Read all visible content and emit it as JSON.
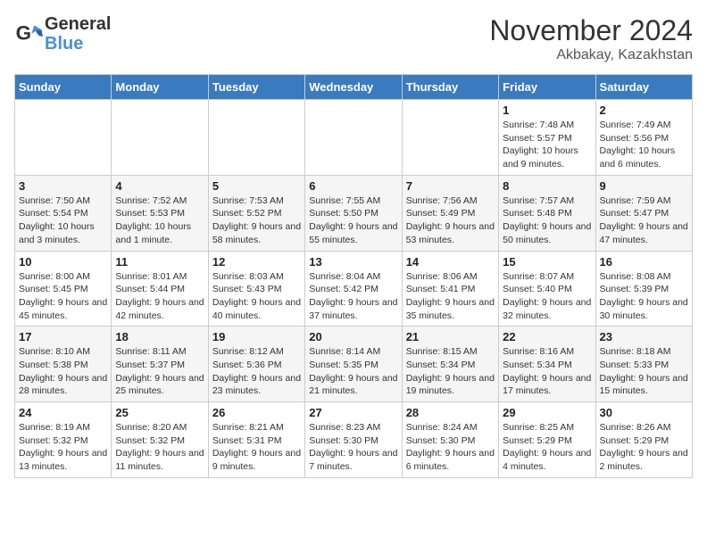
{
  "header": {
    "logo_line1": "General",
    "logo_line2": "Blue",
    "month_title": "November 2024",
    "location": "Akbakay, Kazakhstan"
  },
  "weekdays": [
    "Sunday",
    "Monday",
    "Tuesday",
    "Wednesday",
    "Thursday",
    "Friday",
    "Saturday"
  ],
  "weeks": [
    [
      {
        "day": "",
        "info": ""
      },
      {
        "day": "",
        "info": ""
      },
      {
        "day": "",
        "info": ""
      },
      {
        "day": "",
        "info": ""
      },
      {
        "day": "",
        "info": ""
      },
      {
        "day": "1",
        "info": "Sunrise: 7:48 AM\nSunset: 5:57 PM\nDaylight: 10 hours and 9 minutes."
      },
      {
        "day": "2",
        "info": "Sunrise: 7:49 AM\nSunset: 5:56 PM\nDaylight: 10 hours and 6 minutes."
      }
    ],
    [
      {
        "day": "3",
        "info": "Sunrise: 7:50 AM\nSunset: 5:54 PM\nDaylight: 10 hours and 3 minutes."
      },
      {
        "day": "4",
        "info": "Sunrise: 7:52 AM\nSunset: 5:53 PM\nDaylight: 10 hours and 1 minute."
      },
      {
        "day": "5",
        "info": "Sunrise: 7:53 AM\nSunset: 5:52 PM\nDaylight: 9 hours and 58 minutes."
      },
      {
        "day": "6",
        "info": "Sunrise: 7:55 AM\nSunset: 5:50 PM\nDaylight: 9 hours and 55 minutes."
      },
      {
        "day": "7",
        "info": "Sunrise: 7:56 AM\nSunset: 5:49 PM\nDaylight: 9 hours and 53 minutes."
      },
      {
        "day": "8",
        "info": "Sunrise: 7:57 AM\nSunset: 5:48 PM\nDaylight: 9 hours and 50 minutes."
      },
      {
        "day": "9",
        "info": "Sunrise: 7:59 AM\nSunset: 5:47 PM\nDaylight: 9 hours and 47 minutes."
      }
    ],
    [
      {
        "day": "10",
        "info": "Sunrise: 8:00 AM\nSunset: 5:45 PM\nDaylight: 9 hours and 45 minutes."
      },
      {
        "day": "11",
        "info": "Sunrise: 8:01 AM\nSunset: 5:44 PM\nDaylight: 9 hours and 42 minutes."
      },
      {
        "day": "12",
        "info": "Sunrise: 8:03 AM\nSunset: 5:43 PM\nDaylight: 9 hours and 40 minutes."
      },
      {
        "day": "13",
        "info": "Sunrise: 8:04 AM\nSunset: 5:42 PM\nDaylight: 9 hours and 37 minutes."
      },
      {
        "day": "14",
        "info": "Sunrise: 8:06 AM\nSunset: 5:41 PM\nDaylight: 9 hours and 35 minutes."
      },
      {
        "day": "15",
        "info": "Sunrise: 8:07 AM\nSunset: 5:40 PM\nDaylight: 9 hours and 32 minutes."
      },
      {
        "day": "16",
        "info": "Sunrise: 8:08 AM\nSunset: 5:39 PM\nDaylight: 9 hours and 30 minutes."
      }
    ],
    [
      {
        "day": "17",
        "info": "Sunrise: 8:10 AM\nSunset: 5:38 PM\nDaylight: 9 hours and 28 minutes."
      },
      {
        "day": "18",
        "info": "Sunrise: 8:11 AM\nSunset: 5:37 PM\nDaylight: 9 hours and 25 minutes."
      },
      {
        "day": "19",
        "info": "Sunrise: 8:12 AM\nSunset: 5:36 PM\nDaylight: 9 hours and 23 minutes."
      },
      {
        "day": "20",
        "info": "Sunrise: 8:14 AM\nSunset: 5:35 PM\nDaylight: 9 hours and 21 minutes."
      },
      {
        "day": "21",
        "info": "Sunrise: 8:15 AM\nSunset: 5:34 PM\nDaylight: 9 hours and 19 minutes."
      },
      {
        "day": "22",
        "info": "Sunrise: 8:16 AM\nSunset: 5:34 PM\nDaylight: 9 hours and 17 minutes."
      },
      {
        "day": "23",
        "info": "Sunrise: 8:18 AM\nSunset: 5:33 PM\nDaylight: 9 hours and 15 minutes."
      }
    ],
    [
      {
        "day": "24",
        "info": "Sunrise: 8:19 AM\nSunset: 5:32 PM\nDaylight: 9 hours and 13 minutes."
      },
      {
        "day": "25",
        "info": "Sunrise: 8:20 AM\nSunset: 5:32 PM\nDaylight: 9 hours and 11 minutes."
      },
      {
        "day": "26",
        "info": "Sunrise: 8:21 AM\nSunset: 5:31 PM\nDaylight: 9 hours and 9 minutes."
      },
      {
        "day": "27",
        "info": "Sunrise: 8:23 AM\nSunset: 5:30 PM\nDaylight: 9 hours and 7 minutes."
      },
      {
        "day": "28",
        "info": "Sunrise: 8:24 AM\nSunset: 5:30 PM\nDaylight: 9 hours and 6 minutes."
      },
      {
        "day": "29",
        "info": "Sunrise: 8:25 AM\nSunset: 5:29 PM\nDaylight: 9 hours and 4 minutes."
      },
      {
        "day": "30",
        "info": "Sunrise: 8:26 AM\nSunset: 5:29 PM\nDaylight: 9 hours and 2 minutes."
      }
    ]
  ]
}
